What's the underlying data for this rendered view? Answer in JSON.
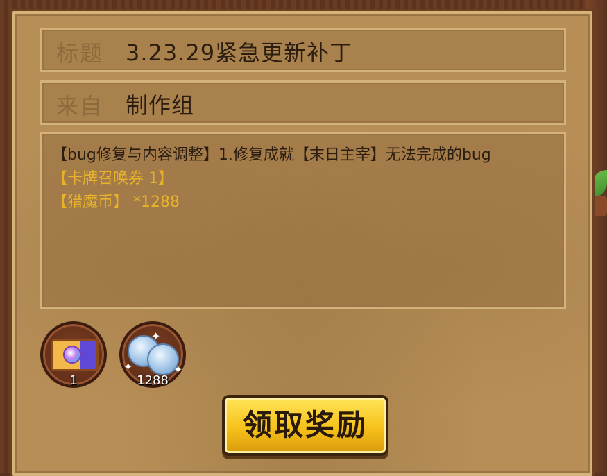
{
  "mail": {
    "title_label": "标题",
    "title_value": "3.23.29紧急更新补丁",
    "from_label": "来自",
    "from_value": "制作组",
    "content_lines": [
      "【bug修复与内容调整】1.修复成就【末日主宰】无法完成的bug",
      "【卡牌召唤券 1】",
      "【猎魔币】 *1288"
    ]
  },
  "rewards": [
    {
      "icon": "summon-ticket-icon",
      "count": "1"
    },
    {
      "icon": "hunting-coin-icon",
      "count": "1288"
    }
  ],
  "actions": {
    "claim_label": "领取奖励"
  },
  "colors": {
    "highlight_text": "#e8b32a",
    "button_yellow": "#f6c21a",
    "panel": "#b78e56"
  }
}
